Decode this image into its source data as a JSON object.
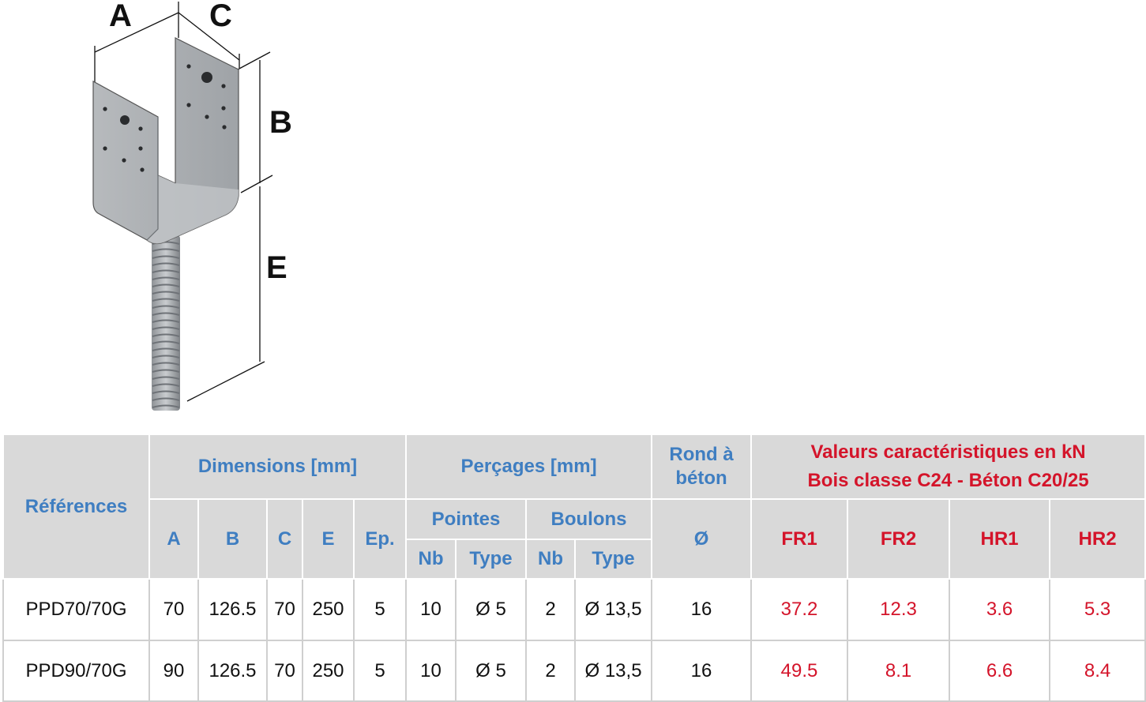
{
  "figure": {
    "dim_labels": {
      "a": "A",
      "b": "B",
      "c": "C",
      "e": "E"
    }
  },
  "table": {
    "col_references": "Références",
    "group_dimensions": "Dimensions [mm]",
    "group_percages": "Perçages [mm]",
    "col_rond_line1": "Rond à",
    "col_rond_line2": "béton",
    "group_valeurs_line1": "Valeurs caractéristiques en kN",
    "group_valeurs_line2": "Bois classe C24 - Béton C20/25",
    "dim_cols": [
      "A",
      "B",
      "C",
      "E",
      "Ep."
    ],
    "sub_pointes": "Pointes",
    "sub_boulons": "Boulons",
    "nb_label": "Nb",
    "type_label": "Type",
    "diam_label": "Ø",
    "value_cols": [
      "FR1",
      "FR2",
      "HR1",
      "HR2"
    ],
    "rows": [
      {
        "ref": "PPD70/70G",
        "a": "70",
        "b": "126.5",
        "c": "70",
        "e": "250",
        "ep": "5",
        "pointes_nb": "10",
        "pointes_type": "Ø 5",
        "boulons_nb": "2",
        "boulons_type": "Ø 13,5",
        "rond": "16",
        "fr1": "37.2",
        "fr2": "12.3",
        "hr1": "3.6",
        "hr2": "5.3"
      },
      {
        "ref": "PPD90/70G",
        "a": "90",
        "b": "126.5",
        "c": "70",
        "e": "250",
        "ep": "5",
        "pointes_nb": "10",
        "pointes_type": "Ø 5",
        "boulons_nb": "2",
        "boulons_type": "Ø 13,5",
        "rond": "16",
        "fr1": "49.5",
        "fr2": "8.1",
        "hr1": "6.6",
        "hr2": "8.4"
      }
    ]
  },
  "colors": {
    "header_bg": "#d9d9d9",
    "header_text": "#3f7ec1",
    "value_text": "#d4142a"
  }
}
